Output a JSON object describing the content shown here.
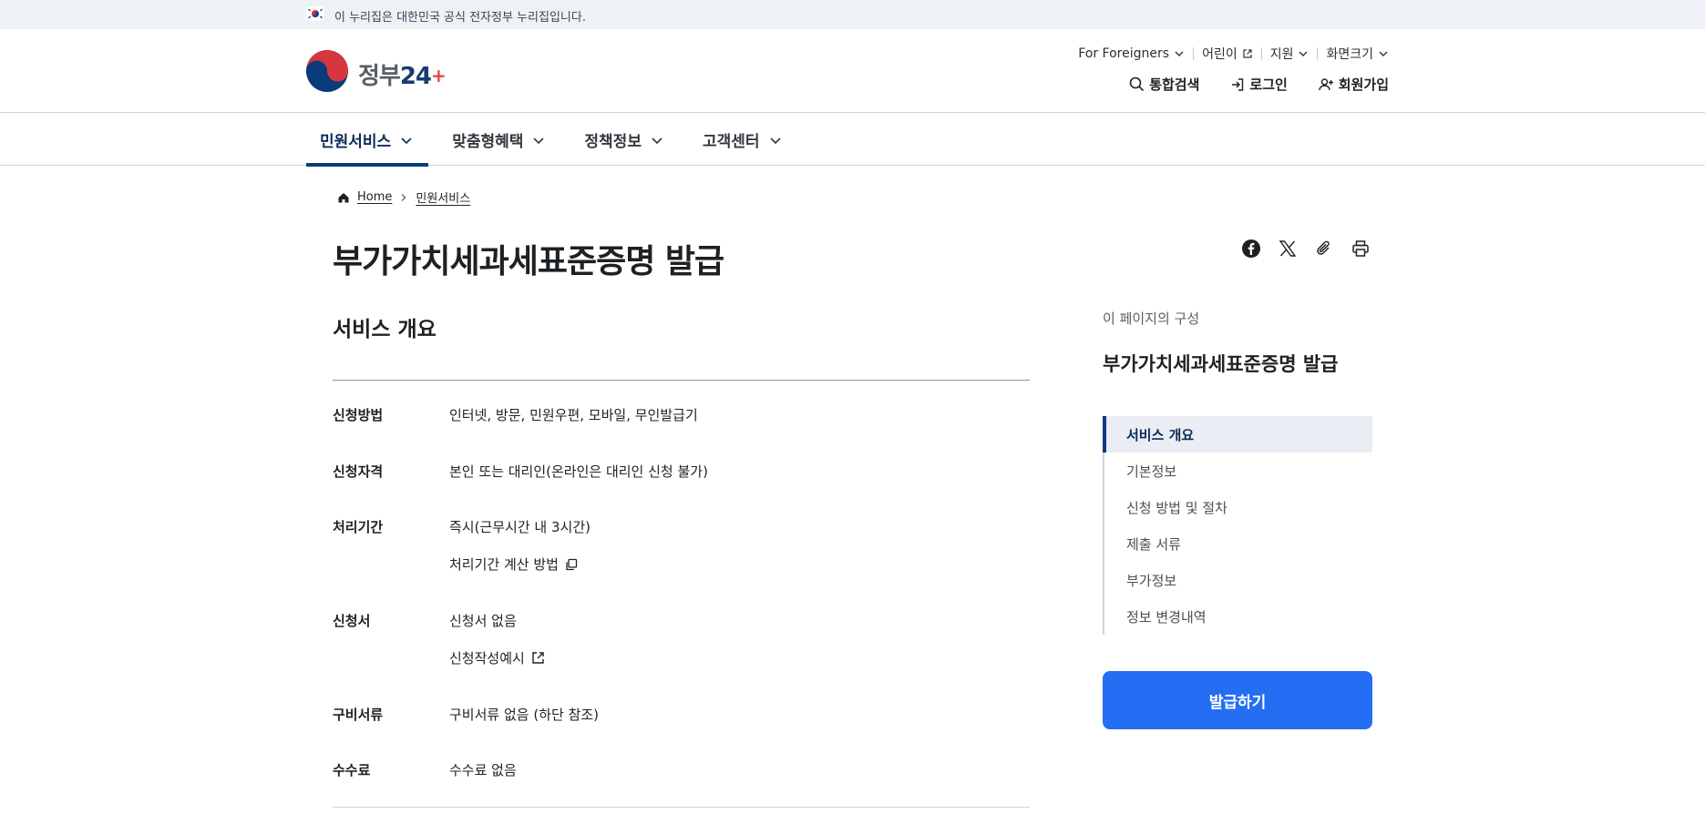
{
  "gov_banner": {
    "text": "이 누리집은 대한민국 공식 전자정부 누리집입니다."
  },
  "logo": {
    "text_main": "정부",
    "text_num": "24",
    "text_plus": "+"
  },
  "utility": {
    "foreigners": "For Foreigners",
    "kids": "어린이",
    "support": "지원",
    "screen_size": "화면크기"
  },
  "actions": {
    "search": "통합검색",
    "login": "로그인",
    "signup": "회원가입"
  },
  "gnb": {
    "items": [
      {
        "label": "민원서비스",
        "active": true
      },
      {
        "label": "맞춤형혜택"
      },
      {
        "label": "정책정보"
      },
      {
        "label": "고객센터"
      }
    ]
  },
  "breadcrumb": {
    "home": "Home",
    "current": "민원서비스"
  },
  "page_title": "부가가치세과세표준증명 발급",
  "section_heading": "서비스 개요",
  "info": {
    "method": {
      "label": "신청방법",
      "value": "인터넷, 방문, 민원우편, 모바일, 무인발급기"
    },
    "eligibility": {
      "label": "신청자격",
      "value": "본인 또는 대리인(온라인은 대리인 신청 불가)"
    },
    "period": {
      "label": "처리기간",
      "value": "즉시(근무시간 내 3시간)",
      "link": "처리기간 계산 방법"
    },
    "form": {
      "label": "신청서",
      "value": "신청서 없음",
      "link": "신청작성예시"
    },
    "docs": {
      "label": "구비서류",
      "value": "구비서류 없음 (하단 참조)"
    },
    "fee": {
      "label": "수수료",
      "value": "수수료 없음"
    }
  },
  "aside": {
    "caption": "이 페이지의 구성",
    "title": "부가가치세과세표준증명 발급",
    "toc": [
      "서비스 개요",
      "기본정보",
      "신청 방법 및 절차",
      "제출 서류",
      "부가정보",
      "정보 변경내역"
    ],
    "button": "발급하기"
  },
  "colors": {
    "primary": "#256ef4",
    "navy": "#0b3b78",
    "banner_bg": "#eef1f6"
  }
}
